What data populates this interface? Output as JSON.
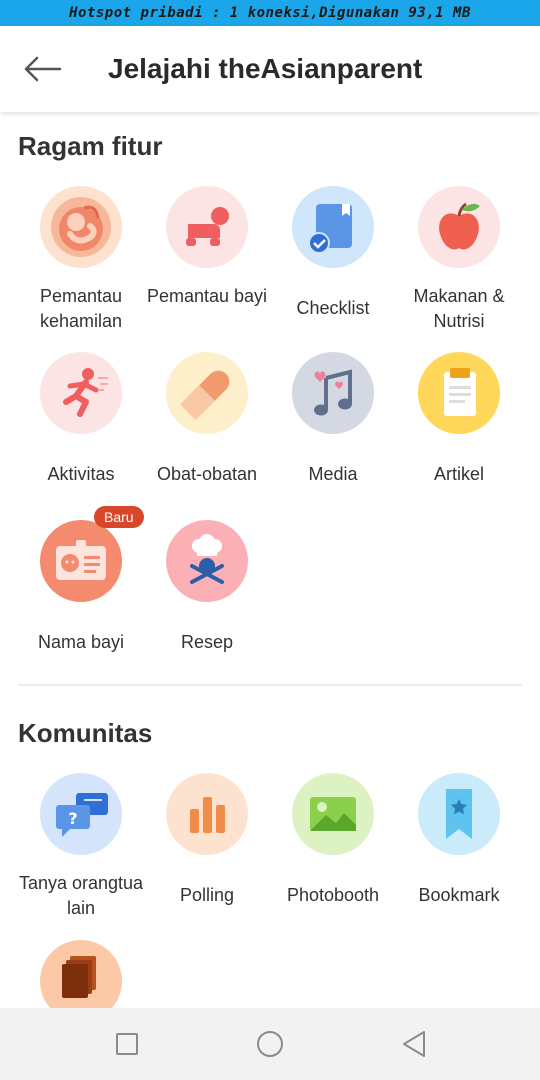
{
  "status_bar": {
    "text": "Hotspot pribadi : 1 koneksi,Digunakan 93,1 MB"
  },
  "header": {
    "title": "Jelajahi theAsianparent",
    "back_icon": "arrow-left-icon"
  },
  "features": {
    "title": "Ragam fitur",
    "items": [
      {
        "label": "Pemantau kehamilan",
        "icon": "fetus-icon"
      },
      {
        "label": "Pemantau bayi",
        "icon": "crawling-baby-icon"
      },
      {
        "label": "Checklist",
        "icon": "checklist-book-icon"
      },
      {
        "label": "Makanan & Nutrisi",
        "icon": "apple-icon"
      },
      {
        "label": "Aktivitas",
        "icon": "running-person-icon"
      },
      {
        "label": "Obat-obatan",
        "icon": "pill-icon"
      },
      {
        "label": "Media",
        "icon": "music-note-icon"
      },
      {
        "label": "Artikel",
        "icon": "clipboard-icon"
      },
      {
        "label": "Nama bayi",
        "icon": "baby-id-card-icon",
        "badge": "Baru"
      },
      {
        "label": "Resep",
        "icon": "chef-hat-icon"
      }
    ]
  },
  "community": {
    "title": "Komunitas",
    "items": [
      {
        "label": "Tanya orangtua lain",
        "icon": "chat-question-icon"
      },
      {
        "label": "Polling",
        "icon": "bar-chart-icon"
      },
      {
        "label": "Photobooth",
        "icon": "photo-icon"
      },
      {
        "label": "Bookmark",
        "icon": "bookmark-icon"
      },
      {
        "label": "",
        "icon": "stacked-cards-icon"
      }
    ]
  },
  "navigation": {
    "recent": "square-icon",
    "home": "circle-icon",
    "back": "triangle-back-icon"
  }
}
